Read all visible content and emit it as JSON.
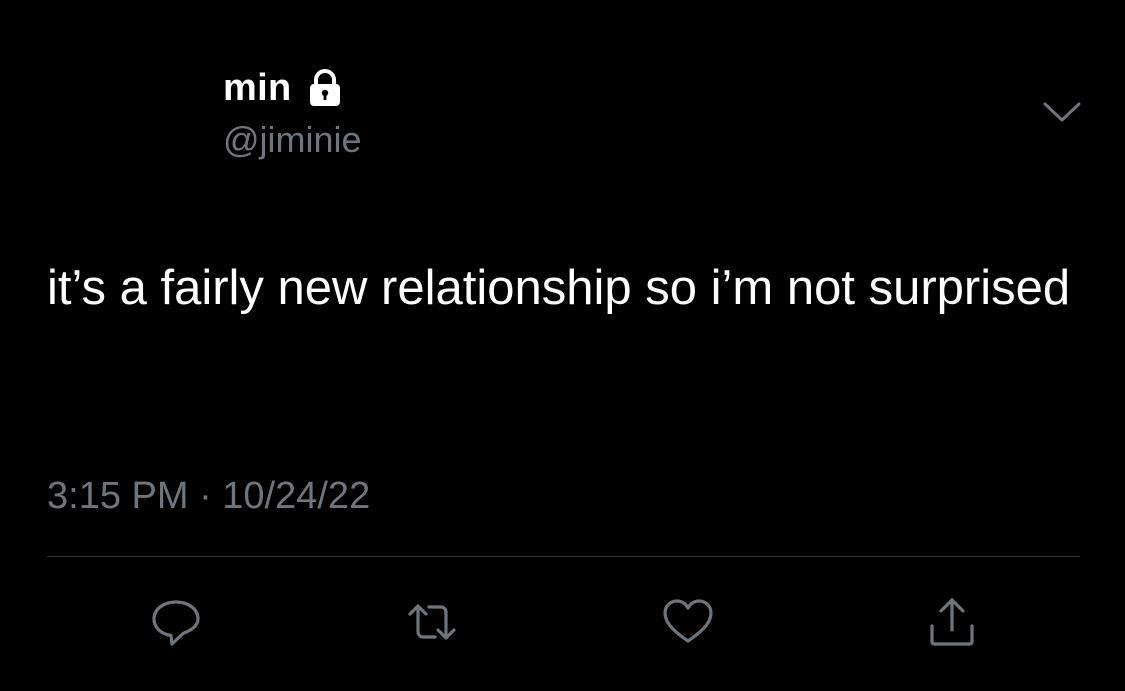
{
  "tweet": {
    "display_name": "min",
    "handle": "@jiminie",
    "text": "it’s a fairly new relationship so i’m not surprised",
    "timestamp": "3:15 PM · 10/24/22",
    "protected": true
  },
  "icons": {
    "lock": "lock-icon",
    "more": "chevron-down-icon",
    "reply": "reply-icon",
    "retweet": "retweet-icon",
    "like": "heart-icon",
    "share": "share-icon"
  },
  "colors": {
    "background": "#000000",
    "text": "#ffffff",
    "secondary_text": "#6e767d",
    "divider": "#2f3336",
    "icon": "#6e767d"
  }
}
